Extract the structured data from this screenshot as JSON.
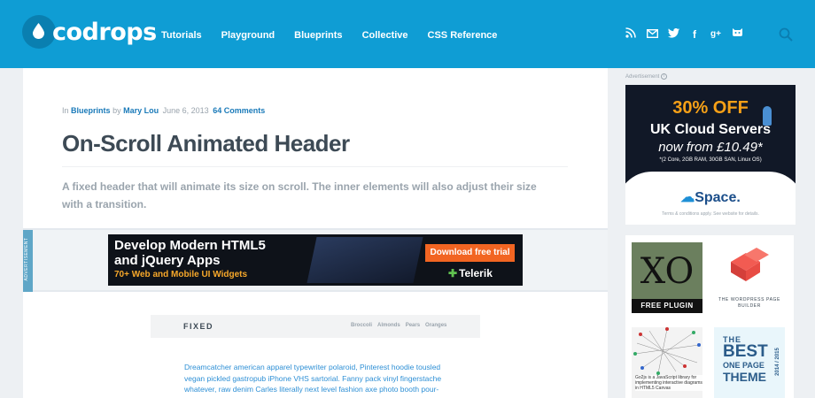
{
  "brand": {
    "logo_text": "codrops",
    "accent": "#0f9dd4"
  },
  "nav": [
    "Tutorials",
    "Playground",
    "Blueprints",
    "Collective",
    "CSS Reference"
  ],
  "social_icons": [
    "rss-icon",
    "mail-icon",
    "twitter-icon",
    "facebook-icon",
    "google-plus-icon",
    "github-icon"
  ],
  "social_glyphs": {
    "facebook": "f",
    "google_plus": "g+"
  },
  "article": {
    "meta_in": "In",
    "category": "Blueprints",
    "meta_by": "by",
    "author": "Mary Lou",
    "date": "June 6, 2013",
    "comments": "64 Comments",
    "title": "On-Scroll Animated Header",
    "lead": "A fixed header that will animate its size on scroll. The inner elements will also adjust their size with a transition."
  },
  "inline_ad": {
    "tag": "ADVERTISEMENT",
    "headline_1": "Develop Modern HTML5",
    "headline_2": "and jQuery Apps",
    "sub": "70+ Web and Mobile UI Widgets",
    "cta": "Download free trial",
    "brand": "Telerik"
  },
  "demo": {
    "header_label": "FIXED",
    "links": [
      "Broccoli",
      "Almonds",
      "Pears",
      "Oranges"
    ],
    "body": "Dreamcatcher american apparel typewriter polaroid, Pinterest hoodie tousled vegan pickled gastropub iPhone VHS sartorial. Fanny pack vinyl fingerstache whatever, raw denim Carles literally next level fashion axe photo booth pour-over"
  },
  "sidebar": {
    "ad_label": "Advertisement",
    "ad": {
      "offer": "30% OFF",
      "product": "UK Cloud Servers",
      "price": "now from £10.49*",
      "specs": "*(2 Core, 2GB RAM, 30GB SAN, Linux OS)",
      "brand": "Space.",
      "terms": "Terms & conditions apply. See website for details."
    },
    "tiles": [
      {
        "label": "FREE PLUGIN",
        "art": "XO"
      },
      {
        "label": "THE WORDPRESS PAGE BUILDER"
      },
      {
        "label": "Go2js is a JavaScript library for implementing interactive diagrams in HTML5 Canvas"
      },
      {
        "t1": "THE",
        "t2": "BEST",
        "t3": "ONE PAGE",
        "t4": "THEME",
        "years": "2014 / 2015"
      }
    ]
  }
}
